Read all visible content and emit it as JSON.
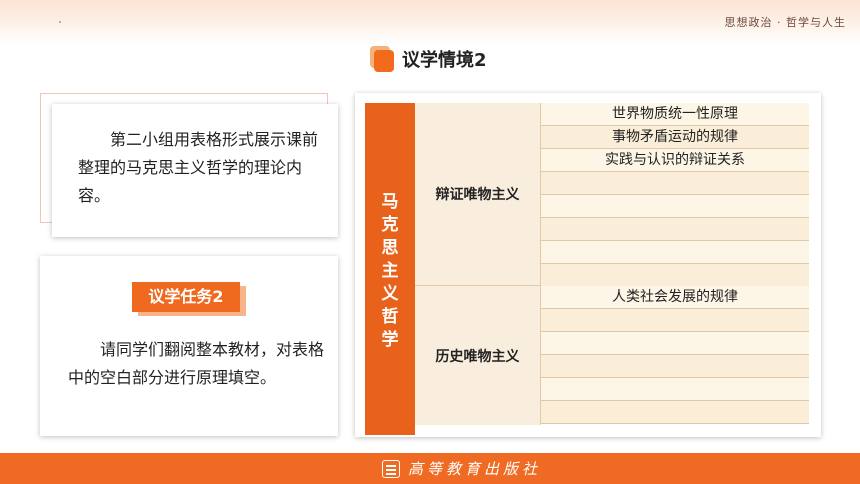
{
  "header": {
    "subject": "思想政治 · 哲学与人生"
  },
  "title": "议学情境2",
  "intro_card": {
    "text": "第二小组用表格形式展示课前整理的马克思主义哲学的理论内容。"
  },
  "task_card": {
    "tag": "议学任务2",
    "text": "请同学们翻阅整本教材，对表格中的空白部分进行原理填空。"
  },
  "table": {
    "side_label": "马克思主义哲学",
    "sections": [
      {
        "category": "辩证唯物主义",
        "rows": [
          "世界物质统一性原理",
          "事物矛盾运动的规律",
          "实践与认识的辩证关系",
          "",
          "",
          "",
          "",
          ""
        ]
      },
      {
        "category": "历史唯物主义",
        "rows": [
          "人类社会发展的规律",
          "",
          "",
          "",
          "",
          ""
        ]
      }
    ]
  },
  "footer": {
    "publisher": "高等教育出版社"
  },
  "colors": {
    "accent": "#ef6a1f",
    "table_side": "#e9621c",
    "row_fill": "#fdf6e6"
  },
  "icons": {
    "title_icon": "stacked-squares-icon",
    "publisher_icon": "book-icon"
  }
}
